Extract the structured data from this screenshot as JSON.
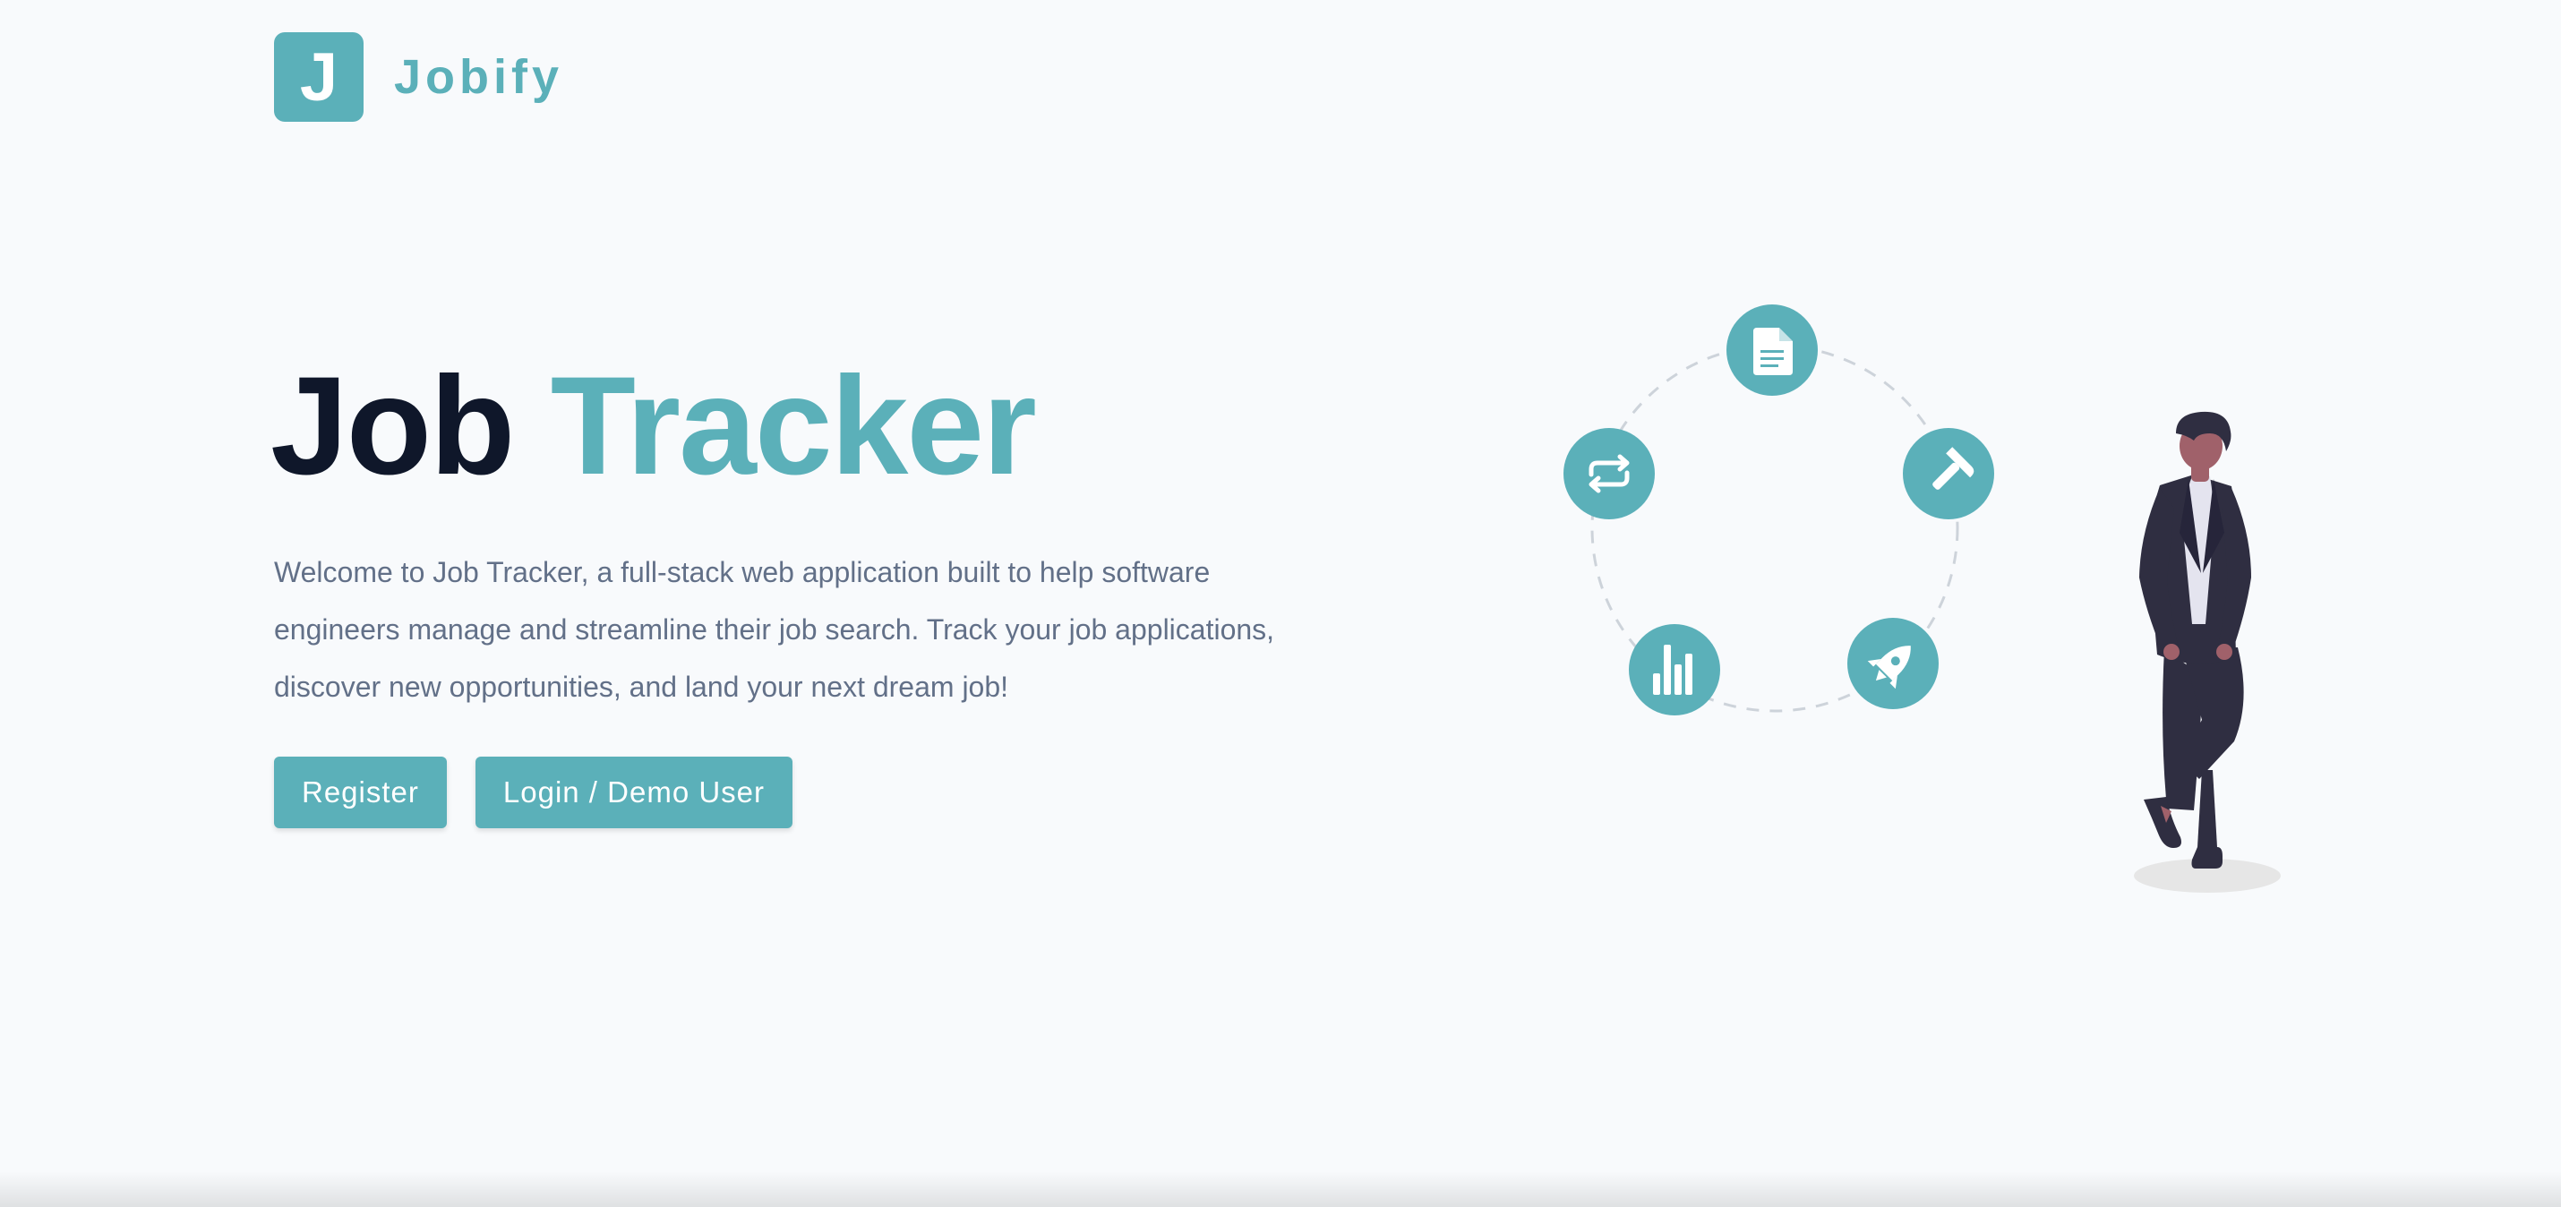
{
  "brand": {
    "logo_letter": "J",
    "name": "Jobify",
    "color": "#5bb0b9"
  },
  "hero": {
    "title_part1": "Job",
    "title_part2": "Tracker",
    "description": "Welcome to Job Tracker, a full-stack web application built to help software engineers manage and streamline their job search. Track your job applications, discover new opportunities, and land your next dream job!"
  },
  "buttons": {
    "register": "Register",
    "login": "Login / Demo User"
  },
  "illustration": {
    "icons": [
      "document-icon",
      "hammer-icon",
      "rocket-icon",
      "bar-chart-icon",
      "repeat-icon"
    ],
    "figure": "standing-person-illustration"
  },
  "colors": {
    "background": "#f8fafc",
    "accent": "#5bb0b9",
    "heading": "#0f172a",
    "body_text": "#627088"
  }
}
